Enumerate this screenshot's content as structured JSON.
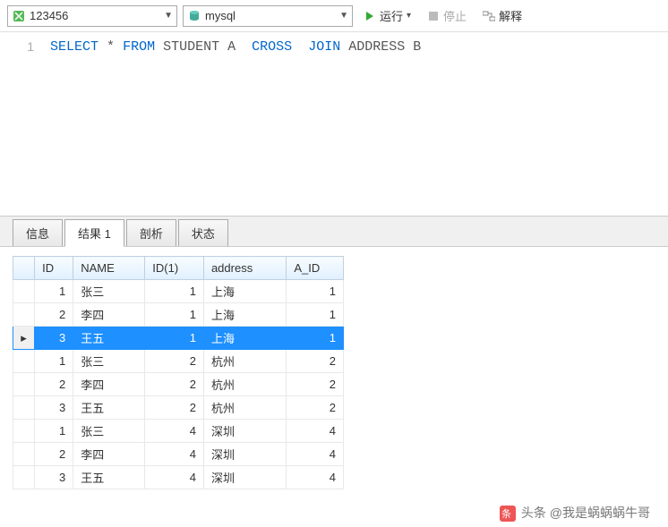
{
  "toolbar": {
    "db": "123456",
    "connection": "mysql",
    "run": "运行",
    "stop": "停止",
    "explain": "解释"
  },
  "editor": {
    "line_number": "1",
    "tokens": {
      "select": "SELECT",
      "star": "*",
      "from": "FROM",
      "student": "STUDENT",
      "a": "A",
      "cross": "CROSS",
      "join": "JOIN",
      "address": "ADDRESS",
      "b": "B"
    }
  },
  "tabs": [
    "信息",
    "结果 1",
    "剖析",
    "状态"
  ],
  "active_tab": 1,
  "grid": {
    "headers": [
      "ID",
      "NAME",
      "ID(1)",
      "address",
      "A_ID"
    ],
    "rows": [
      {
        "sel": false,
        "cells": [
          "1",
          "张三",
          "1",
          "上海",
          "1"
        ]
      },
      {
        "sel": false,
        "cells": [
          "2",
          "李四",
          "1",
          "上海",
          "1"
        ]
      },
      {
        "sel": true,
        "cells": [
          "3",
          "王五",
          "1",
          "上海",
          "1"
        ]
      },
      {
        "sel": false,
        "cells": [
          "1",
          "张三",
          "2",
          "杭州",
          "2"
        ]
      },
      {
        "sel": false,
        "cells": [
          "2",
          "李四",
          "2",
          "杭州",
          "2"
        ]
      },
      {
        "sel": false,
        "cells": [
          "3",
          "王五",
          "2",
          "杭州",
          "2"
        ]
      },
      {
        "sel": false,
        "cells": [
          "1",
          "张三",
          "4",
          "深圳",
          "4"
        ]
      },
      {
        "sel": false,
        "cells": [
          "2",
          "李四",
          "4",
          "深圳",
          "4"
        ]
      },
      {
        "sel": false,
        "cells": [
          "3",
          "王五",
          "4",
          "深圳",
          "4"
        ]
      }
    ]
  },
  "watermark": "头条 @我是蜗蜗蜗牛哥"
}
